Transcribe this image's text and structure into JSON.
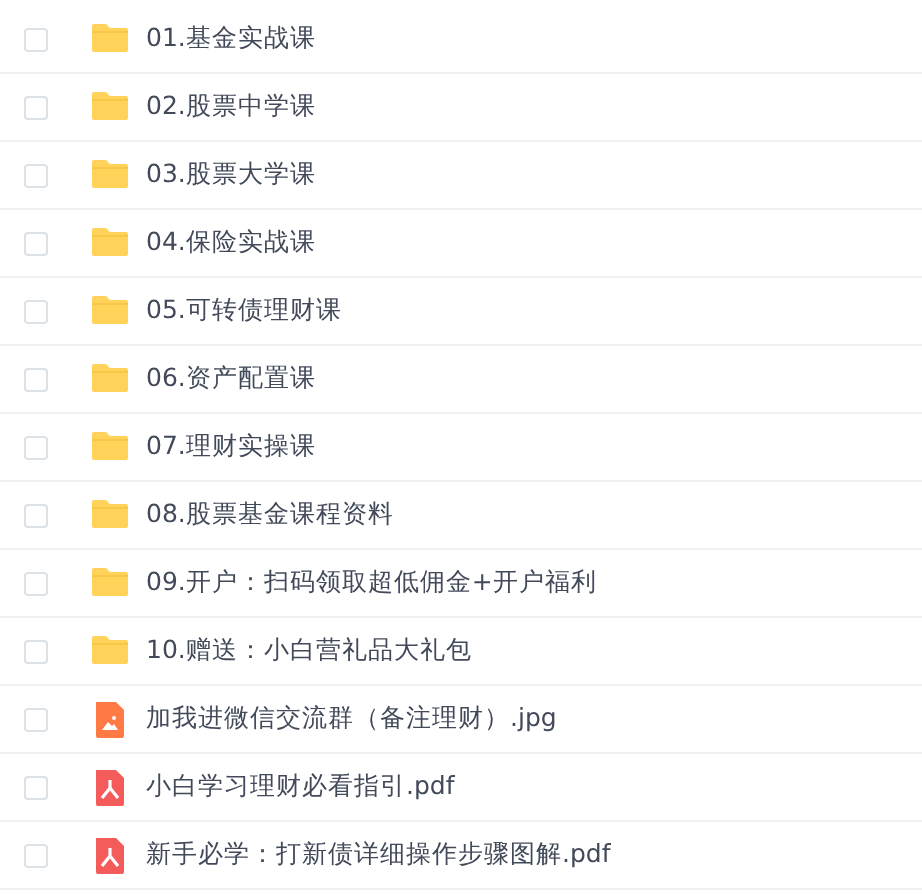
{
  "files": [
    {
      "kind": "folder",
      "name": "01.基金实战课",
      "checked": false
    },
    {
      "kind": "folder",
      "name": "02.股票中学课",
      "checked": false
    },
    {
      "kind": "folder",
      "name": "03.股票大学课",
      "checked": false
    },
    {
      "kind": "folder",
      "name": "04.保险实战课",
      "checked": false
    },
    {
      "kind": "folder",
      "name": "05.可转债理财课",
      "checked": false
    },
    {
      "kind": "folder",
      "name": "06.资产配置课",
      "checked": false
    },
    {
      "kind": "folder",
      "name": "07.理财实操课",
      "checked": false
    },
    {
      "kind": "folder",
      "name": "08.股票基金课程资料",
      "checked": false
    },
    {
      "kind": "folder",
      "name": "09.开户：扫码领取超低佣金+开户福利",
      "checked": false
    },
    {
      "kind": "folder",
      "name": "10.赠送：小白营礼品大礼包",
      "checked": false
    },
    {
      "kind": "image",
      "name": "加我进微信交流群（备注理财）.jpg",
      "checked": false
    },
    {
      "kind": "pdf",
      "name": "小白学习理财必看指引.pdf",
      "checked": false
    },
    {
      "kind": "pdf",
      "name": "新手必学：打新债详细操作步骤图解.pdf",
      "checked": false
    }
  ]
}
